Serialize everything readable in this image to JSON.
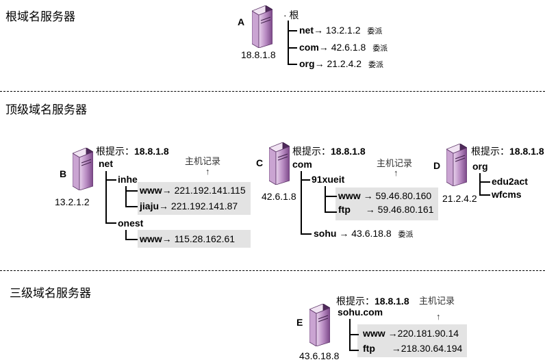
{
  "levels": {
    "root": "根域名服务器",
    "top": "顶级域名服务器",
    "third": "三级域名服务器"
  },
  "labels": {
    "hint": "根提示：",
    "host_record": "主机记录",
    "delegate": "委派",
    "up_arrow": "↑"
  },
  "server_a": {
    "letter": "A",
    "ip": "18.8.1.8",
    "zone": "· 根",
    "records": [
      {
        "name": "net",
        "arrow": "→",
        "target": "13.2.1.2"
      },
      {
        "name": "com",
        "arrow": "→",
        "target": "42.6.1.8"
      },
      {
        "name": "org",
        "arrow": "→",
        "target": "21.2.4.2"
      }
    ]
  },
  "server_b": {
    "letter": "B",
    "ip": "13.2.1.2",
    "hint_ip": "18.8.1.8",
    "zone": "net",
    "sub1": "inhe",
    "sub1_records": [
      {
        "name": "www",
        "arrow": "→",
        "target": "221.192.141.115"
      },
      {
        "name": "jiaju",
        "arrow": "→",
        "target": "221.192.141.87"
      }
    ],
    "sub2": "onest",
    "sub2_records": [
      {
        "name": "www",
        "arrow": "→",
        "target": "115.28.162.61"
      }
    ]
  },
  "server_c": {
    "letter": "C",
    "ip": "42.6.1.8",
    "hint_ip": "18.8.1.8",
    "zone": "com",
    "sub1": "91xueit",
    "sub1_records": [
      {
        "name": "www",
        "arrow": "→",
        "target": "59.46.80.160"
      },
      {
        "name": "ftp",
        "arrow": "→",
        "target": "59.46.80.161"
      }
    ],
    "sub2": "sohu",
    "sub2_arrow": "→",
    "sub2_target": "43.6.18.8"
  },
  "server_d": {
    "letter": "D",
    "ip": "21.2.4.2",
    "hint_ip": "18.8.1.8",
    "zone": "org",
    "subs": [
      "edu2act",
      "wfcms"
    ]
  },
  "server_e": {
    "letter": "E",
    "ip": "43.6.18.8",
    "hint_ip": "18.8.1.8",
    "zone": "sohu.com",
    "records": [
      {
        "name": "www",
        "arrow": "→",
        "target": "220.181.90.14"
      },
      {
        "name": "ftp",
        "arrow": "→",
        "target": "218.30.64.194"
      }
    ]
  },
  "colors": {
    "server_light": "#d6b3dc",
    "server_dark": "#6b3a78",
    "highlight": "#e3e3e3"
  }
}
